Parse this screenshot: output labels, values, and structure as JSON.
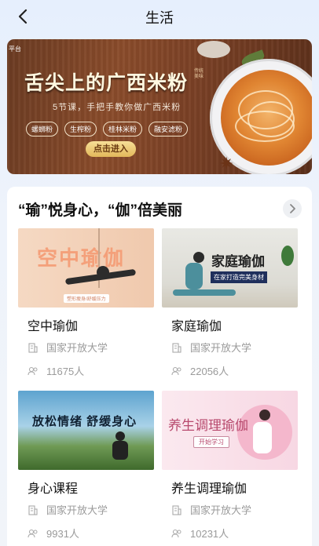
{
  "nav": {
    "title": "生活"
  },
  "banner": {
    "corner_tag": "平台",
    "title": "舌尖上的广西米粉",
    "seal_text": "传统美味",
    "subtitle": "5节课，手把手教你做广西米粉",
    "chips": [
      "螺蛳粉",
      "生榨粉",
      "桂林米粉",
      "融安滤粉"
    ],
    "cta": "点击进入",
    "dots_total": 5,
    "active_dot": 0
  },
  "section": {
    "title": "“瑜”悦身心，“伽”倍美丽",
    "courses": [
      {
        "name": "空中瑜伽",
        "school": "国家开放大学",
        "learners": "11675人",
        "thumb_text": "空中瑜伽",
        "thumb_badge": "塑形瘦身/舒缓压力"
      },
      {
        "name": "家庭瑜伽",
        "school": "国家开放大学",
        "learners": "22056人",
        "thumb_text": "家庭瑜伽",
        "thumb_badge": "在家打造完美身材"
      },
      {
        "name": "身心课程",
        "school": "国家开放大学",
        "learners": "9931人",
        "thumb_text": "放松情绪  舒缓身心",
        "thumb_badge": ""
      },
      {
        "name": "养生调理瑜伽",
        "school": "国家开放大学",
        "learners": "10231人",
        "thumb_text": "养生调理瑜伽",
        "thumb_badge": "开始学习"
      }
    ]
  },
  "colors": {
    "accent_orange": "#f0a376",
    "brand_blue": "#e6effd"
  },
  "icons": {
    "back": "back-arrow-icon",
    "more": "chevron-right-icon",
    "school": "building-icon",
    "learners": "people-icon"
  }
}
